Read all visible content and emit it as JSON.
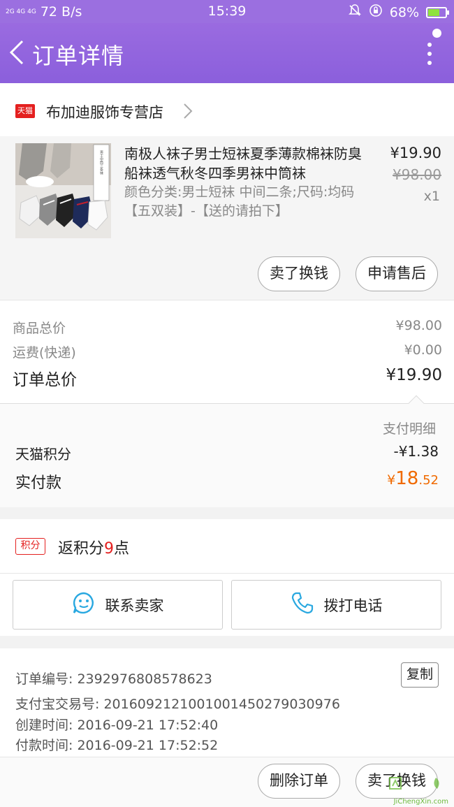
{
  "status_bar": {
    "network": "2G 4G 4G",
    "speed": "72 B/s",
    "time": "15:39",
    "battery": "68%",
    "battery_level": 0.68
  },
  "header": {
    "title": "订单详情"
  },
  "shop": {
    "badge": "天猫",
    "name": "布加迪服饰专营店"
  },
  "product": {
    "title": "南极人袜子男士短袜夏季薄款棉袜防臭船袜透气秋冬四季男袜中筒袜",
    "sku": "颜色分类:男士短袜 中间二条;尺码:均码【五双装】-【送的请拍下】",
    "price": "¥19.90",
    "original_price": "¥98.00",
    "qty": "x1",
    "thumb_label": "男士中筒三条袜"
  },
  "actions": {
    "sell": "卖了换钱",
    "aftersale": "申请售后"
  },
  "totals": {
    "goods_label": "商品总价",
    "goods_value": "¥98.00",
    "ship_label": "运费(快递)",
    "ship_value": "¥0.00",
    "order_label": "订单总价",
    "order_value": "¥19.90"
  },
  "pay_detail": {
    "link": "支付明细",
    "points_label": "天猫积分",
    "points_value": "-¥1.38",
    "paid_label": "实付款",
    "paid_currency": "¥",
    "paid_int": "18",
    "paid_dec": ".52"
  },
  "points": {
    "badge": "积分",
    "prefix": "返积分",
    "count": "9",
    "suffix": "点"
  },
  "contact": {
    "seller": "联系卖家",
    "call": "拨打电话"
  },
  "order_info": {
    "order_no": "订单编号: 2392976808578623",
    "alipay_no": "支付宝交易号: 2016092121001001450279030976",
    "created": "创建时间: 2016-09-21 17:52:40",
    "paid_time": "付款时间: 2016-09-21 17:52:52",
    "copy": "复制"
  },
  "bottom": {
    "delete": "删除订单",
    "sell": "卖了换钱"
  },
  "watermark": "JiChengXin.com",
  "colors": {
    "header": "#8b5fdc",
    "accent_red": "#e4201f",
    "paid_orange": "#f06a00"
  }
}
